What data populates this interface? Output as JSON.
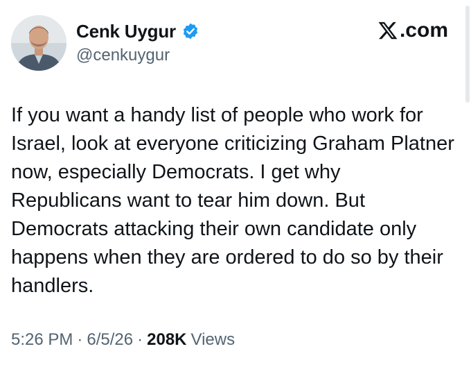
{
  "author": {
    "display_name": "Cenk Uygur",
    "handle": "@cenkuygur",
    "verified": true,
    "avatar_icon": "profile-photo"
  },
  "brand": {
    "label": ".com",
    "icon": "x-logo-icon"
  },
  "tweet": {
    "text": "If you want a handy list of people who work for Israel, look at everyone criticizing Graham Platner now, especially Democrats. I get why Republicans want to tear him down. But Democrats attacking their own candidate only happens when they are ordered to do so by their handlers."
  },
  "meta": {
    "time": "5:26 PM",
    "sep1": "·",
    "date": "6/5/26",
    "sep2": "·",
    "views_count": "208K",
    "views_label": "Views"
  },
  "colors": {
    "text": "#0f1419",
    "secondary": "#536471",
    "verified_blue": "#1d9bf0"
  }
}
